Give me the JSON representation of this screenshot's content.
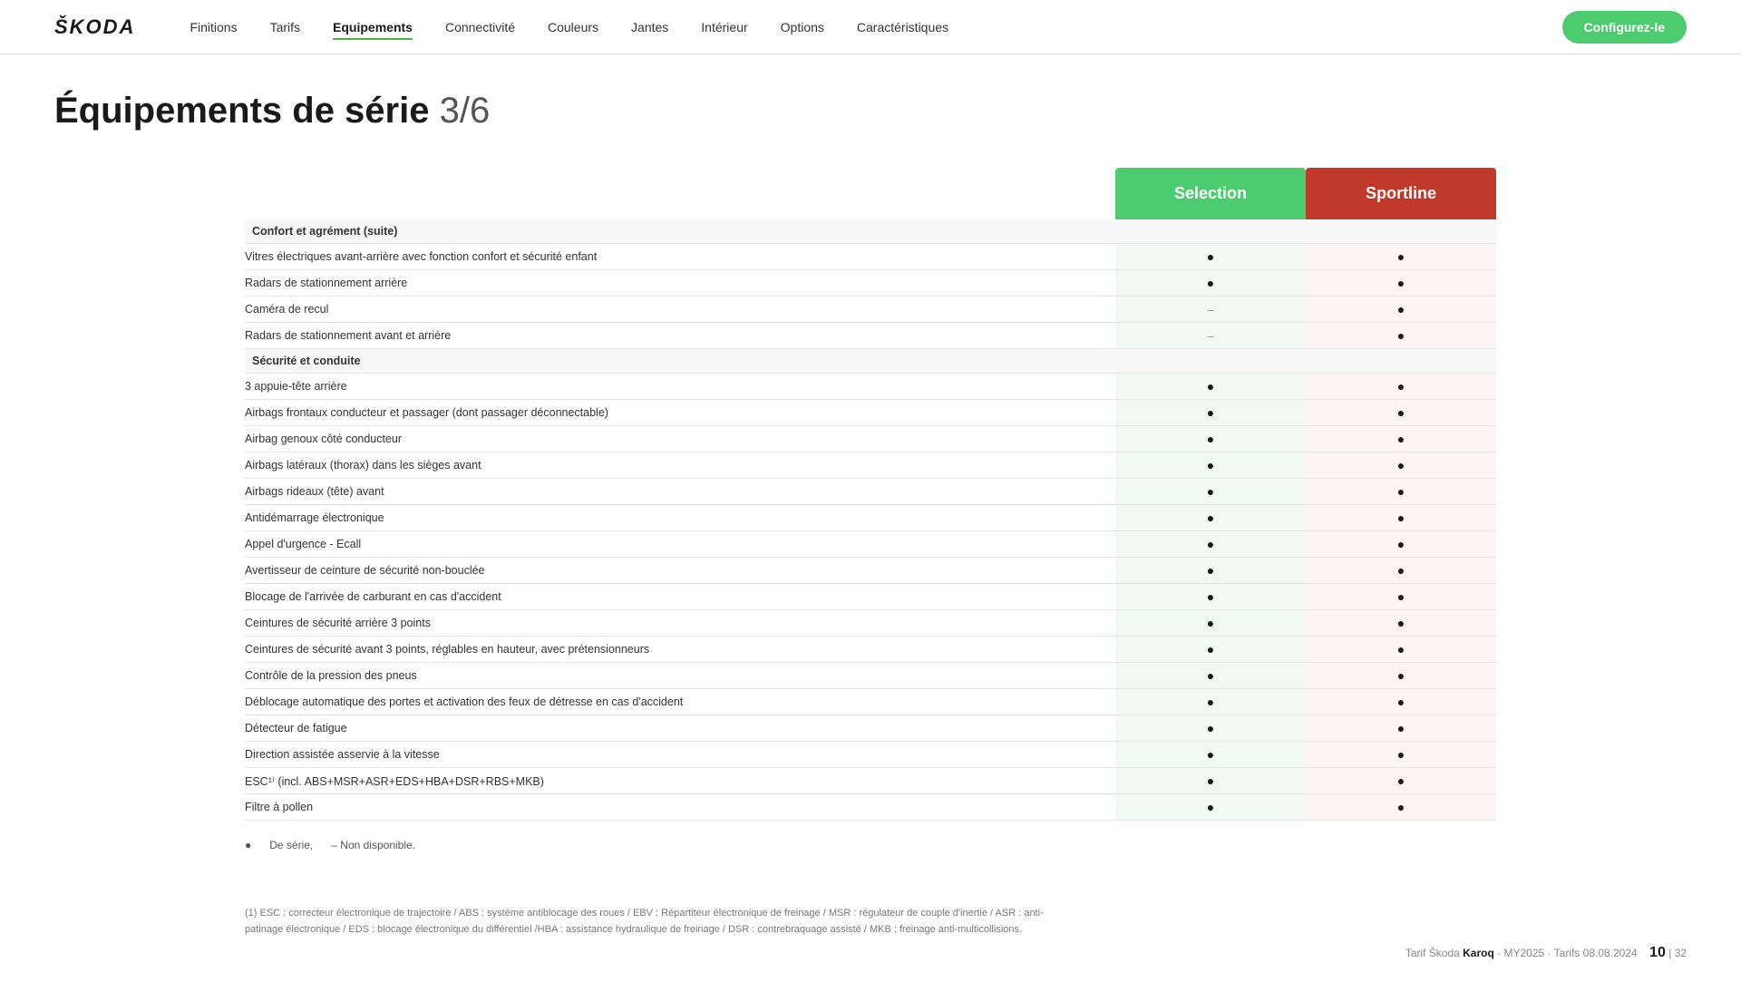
{
  "logo": "ŠKODA",
  "nav": {
    "links": [
      {
        "label": "Finitions",
        "active": false
      },
      {
        "label": "Tarifs",
        "active": false
      },
      {
        "label": "Equipements",
        "active": true
      },
      {
        "label": "Connectivité",
        "active": false
      },
      {
        "label": "Couleurs",
        "active": false
      },
      {
        "label": "Jantes",
        "active": false
      },
      {
        "label": "Intérieur",
        "active": false
      },
      {
        "label": "Options",
        "active": false
      },
      {
        "label": "Caractéristiques",
        "active": false
      }
    ],
    "cta": "Configurez-le"
  },
  "page": {
    "title": "Équipements de série",
    "step": "3/6"
  },
  "columns": {
    "selection": "Selection",
    "sportline": "Sportline"
  },
  "sections": [
    {
      "title": "Confort et agrément (suite)",
      "items": [
        {
          "feature": "Vitres électriques avant-arrière avec fonction confort et sécurité enfant",
          "sel": "●",
          "sport": "●"
        },
        {
          "feature": "Radars de stationnement arrière",
          "sel": "●",
          "sport": "●"
        },
        {
          "feature": "Caméra de recul",
          "sel": "–",
          "sport": "●"
        },
        {
          "feature": "Radars de stationnement avant et arrière",
          "sel": "–",
          "sport": "●"
        }
      ]
    },
    {
      "title": "Sécurité et conduite",
      "items": [
        {
          "feature": "3 appuie-tête arrière",
          "sel": "●",
          "sport": "●"
        },
        {
          "feature": "Airbags frontaux conducteur et passager (dont passager déconnectable)",
          "sel": "●",
          "sport": "●"
        },
        {
          "feature": "Airbag genoux côté conducteur",
          "sel": "●",
          "sport": "●"
        },
        {
          "feature": "Airbags latéraux (thorax) dans les sièges avant",
          "sel": "●",
          "sport": "●"
        },
        {
          "feature": "Airbags rideaux (tête) avant",
          "sel": "●",
          "sport": "●"
        },
        {
          "feature": "Antidémarrage électronique",
          "sel": "●",
          "sport": "●"
        },
        {
          "feature": "Appel d'urgence - Ecall",
          "sel": "●",
          "sport": "●"
        },
        {
          "feature": "Avertisseur de ceinture de sécurité non-bouclée",
          "sel": "●",
          "sport": "●"
        },
        {
          "feature": "Blocage de l'arrivée de carburant en cas d'accident",
          "sel": "●",
          "sport": "●"
        },
        {
          "feature": "Ceintures de sécurité arrière 3 points",
          "sel": "●",
          "sport": "●"
        },
        {
          "feature": "Ceintures de sécurité avant 3 points, réglables en hauteur, avec prétensionneurs",
          "sel": "●",
          "sport": "●"
        },
        {
          "feature": "Contrôle de la pression des pneus",
          "sel": "●",
          "sport": "●"
        },
        {
          "feature": "Déblocage automatique des portes et activation des feux de détresse en cas d'accident",
          "sel": "●",
          "sport": "●"
        },
        {
          "feature": "Détecteur de fatigue",
          "sel": "●",
          "sport": "●"
        },
        {
          "feature": "Direction assistée asservie à la vitesse",
          "sel": "●",
          "sport": "●"
        },
        {
          "feature": "ESC¹⁾ (incl. ABS+MSR+ASR+EDS+HBA+DSR+RBS+MKB)",
          "sel": "●",
          "sport": "●"
        },
        {
          "feature": "Filtre à pollen",
          "sel": "●",
          "sport": "●"
        }
      ]
    }
  ],
  "legend": {
    "bullet_label": "De série,",
    "dash_label": "– Non disponible."
  },
  "footnote": "(1) ESC : correcteur électronique de trajectoire / ABS : système antiblocage des roues / EBV : Répartiteur électronique de freinage / MSR : régulateur de couple d'inertie / ASR : anti-patinage électronique / EDS : blocage électronique du différentiel /HBA : assistance hydraulique de freinage / DSR : contrebraquage assisté / MKB : freinage anti-multicollisions.",
  "footer": {
    "tarif_label": "Tarif Škoda",
    "model": "Karoq",
    "year": "MY2025",
    "date": "Tarifs 08.08.2024",
    "page_current": "10",
    "page_total": "32"
  }
}
